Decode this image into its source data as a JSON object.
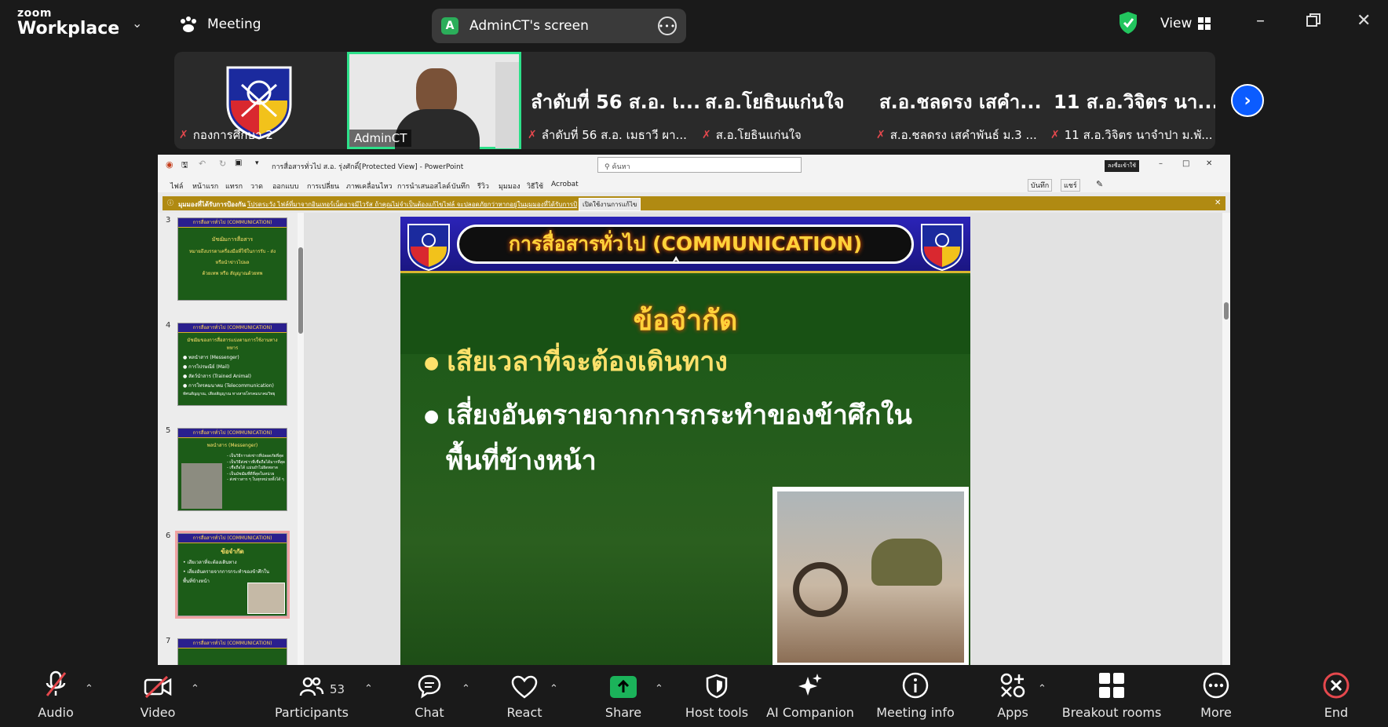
{
  "app": {
    "brand_line1": "zoom",
    "brand_line2": "Workplace",
    "meeting_label": "Meeting",
    "view_label": "View"
  },
  "shared_screen_pill": {
    "avatar_letter": "A",
    "title": "AdminCT's screen"
  },
  "participants_strip": [
    {
      "big": "",
      "label": "กองการศึกษา 2"
    },
    {
      "big": "",
      "label": "AdminCT"
    },
    {
      "big": "ลำดับที่ 56 ส.อ. เ...",
      "label": "ลำดับที่ 56 ส.อ. เมธาวี  ผา..."
    },
    {
      "big": "ส.อ.โยธินแก่นใจ",
      "label": "ส.อ.โยธินแก่นใจ"
    },
    {
      "big": "ส.อ.ชลดรง เสคำ...",
      "label": "ส.อ.ชลดรง เสคำพันธ์ ม.3 ..."
    },
    {
      "big": "11 ส.อ.วิจิตร นา...",
      "label": "11 ส.อ.วิจิตร นาจำปา ม.พั..."
    }
  ],
  "powerpoint": {
    "title": "การสื่อสารทั่วไป ส.อ. รุ่งศักดิ์[Protected View] - PowerPoint",
    "search_placeholder": "ค้นหา",
    "badge": "ลงชื่อเข้าใช้",
    "menu": [
      "ไฟล์",
      "หน้าแรก",
      "แทรก",
      "วาด",
      "ออกแบบ",
      "การเปลี่ยน",
      "ภาพเคลื่อนไหว",
      "การนำเสนอสไลด์",
      "บันทึก",
      "รีวิว",
      "มุมมอง",
      "วิธีใช้",
      "Acrobat"
    ],
    "menu_right": [
      "บันทึก",
      "แชร์"
    ],
    "warning_label": "มุมมองที่ได้รับการป้องกัน",
    "warning_text": "โปรดระวัง ไฟล์ที่มาจากอินเทอร์เน็ตอาจมีไวรัส ถ้าคุณไม่จำเป็นต้องแก้ไขไฟล์ จะปลอดภัยกว่าหากอยู่ในมุมมองที่ได้รับการป้องกัน",
    "warning_button": "เปิดใช้งานการแก้ไข",
    "thumbs": [
      {
        "num": "3",
        "header": "การสื่อสารทั่วไป (COMMUNICATION)",
        "lines": [
          "มัชฌิมการสื่อสาร",
          "หมายถึงบรรดาเครื่องมือที่ใช้ในการรับ - ส่ง",
          "หรือนำข่าวไปผล",
          "ด้วยเทพ หรือ สัญญาณด้วยทพ"
        ]
      },
      {
        "num": "4",
        "header": "การสื่อสารทั่วไป (COMMUNICATION)",
        "lines": [
          "มัชฌิมของการสื่อสารแบ่งตามการใช้งานทาง",
          "ทหาร",
          "● พลนำสาร (Messenger)",
          "● การไปรษณีย์ (Mail)",
          "● สัตว์นำสาร (Trained Animal)",
          "● การโทรคมนาคม (Telecommunication)",
          "ทัศนสัญญาณ, เสียงสัญญาณ ทางสายโทรคมนาคมวิทยุ"
        ]
      },
      {
        "num": "5",
        "header": "การสื่อสารทั่วไป (COMMUNICATION)",
        "lines": [
          "พลนำสาร (Messenger)",
          "- เป็นวิธีการส่งข่าวที่ปลอดภัยที่สุด",
          "- เป็นวิธีส่งข่าวที่เชื่อถือได้มากที่สุด",
          "- เชื่อถือได้ แม่นยำไม่ผิดพลาด",
          "- เป็นมัชฌิมที่ดีที่สุดในหน่วย",
          "- ส่งข่าวสาร ๆ ในทุกหน่วยทั้งได้ ๆ"
        ]
      },
      {
        "num": "6",
        "header": "การสื่อสารทั่วไป (COMMUNICATION)",
        "lines": [
          "ข้อจำกัด",
          "• เสียเวลาที่จะต้องเดินทาง",
          "• เสี่ยงอันตรายจากการกระทำของข้าศึกใน",
          "  พื้นที่ข้างหน้า"
        ]
      },
      {
        "num": "7",
        "header": "การสื่อสารทั่วไป (COMMUNICATION)",
        "lines": []
      }
    ],
    "slide": {
      "header": "การสื่อสารทั่วไป (COMMUNICATION)",
      "subtitle": "ข้อจำกัด",
      "bullets": [
        "เสียเวลาที่จะต้องเดินทาง",
        "เสี่ยงอันตรายจากการกระทำของข้าศึกใน",
        "พื้นที่ข้างหน้า"
      ]
    }
  },
  "toolbar": {
    "audio": "Audio",
    "video": "Video",
    "participants": "Participants",
    "participants_count": "53",
    "chat": "Chat",
    "react": "React",
    "share": "Share",
    "host_tools": "Host tools",
    "ai_companion": "AI Companion",
    "meeting_info": "Meeting info",
    "apps": "Apps",
    "breakout_rooms": "Breakout rooms",
    "more": "More",
    "end": "End"
  },
  "colors": {
    "accent_blue": "#0b5cff",
    "share_green": "#1bb35a",
    "end_red": "#e5484d",
    "highlight_green": "#2de08a",
    "slide_green": "#1d5a17",
    "slide_title_yellow": "#ffd23a"
  }
}
